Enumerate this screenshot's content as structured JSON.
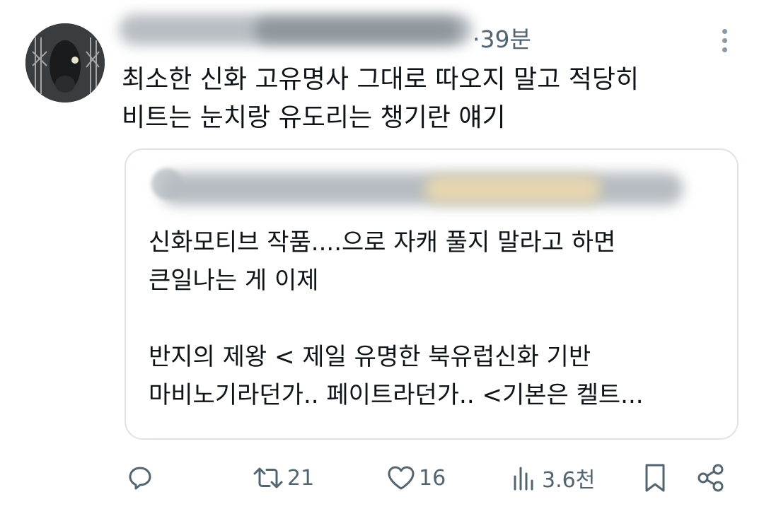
{
  "tweet": {
    "time": "·39분",
    "text": "최소한 신화 고유명사 그대로 따오지 말고 적당히\n비트는 눈치랑 유도리는 챙기란 얘기"
  },
  "quote": {
    "text": "신화모티브 작품....으로 자캐 풀지 말라고 하면\n큰일나는 게 이제\n\n반지의 제왕 < 제일 유명한 북유럽신화 기반\n마비노기라던가.. 페이트라던가.. <기본은 켈트..."
  },
  "actions": {
    "reply": {
      "icon": "reply-icon"
    },
    "retweet": {
      "icon": "retweet-icon",
      "count": "21"
    },
    "like": {
      "icon": "heart-icon",
      "count": "16"
    },
    "views": {
      "icon": "views-icon",
      "count": "3.6천"
    },
    "bookmark": {
      "icon": "bookmark-icon"
    },
    "share": {
      "icon": "share-icon"
    }
  },
  "icons": {
    "more": "more-vertical-icon"
  },
  "colors": {
    "text": "#0f1419",
    "secondary": "#536471",
    "border": "#dfe3e7",
    "more_dots": "#8b98a5"
  }
}
